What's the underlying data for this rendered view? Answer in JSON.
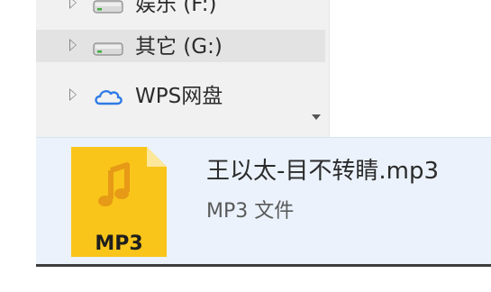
{
  "navigation": {
    "items": [
      {
        "label": "娱乐 (F:)",
        "icon": "drive-icon"
      },
      {
        "label": "其它 (G:)",
        "icon": "drive-icon",
        "selected": true
      },
      {
        "label": "WPS网盘",
        "icon": "cloud-icon"
      }
    ]
  },
  "details_pane": {
    "file_name": "王以太-目不转睛.mp3",
    "file_type": "MP3 文件",
    "icon_badge": "MP3",
    "icon": "music-file-icon"
  },
  "colors": {
    "nav_bg": "#f1f1f1",
    "selected_bg": "#e3e3e3",
    "details_bg": "#ebf2fb",
    "file_icon_yellow": "#f9c51a",
    "note_orange": "#e69a16",
    "cloud_blue": "#2f7ae5"
  }
}
